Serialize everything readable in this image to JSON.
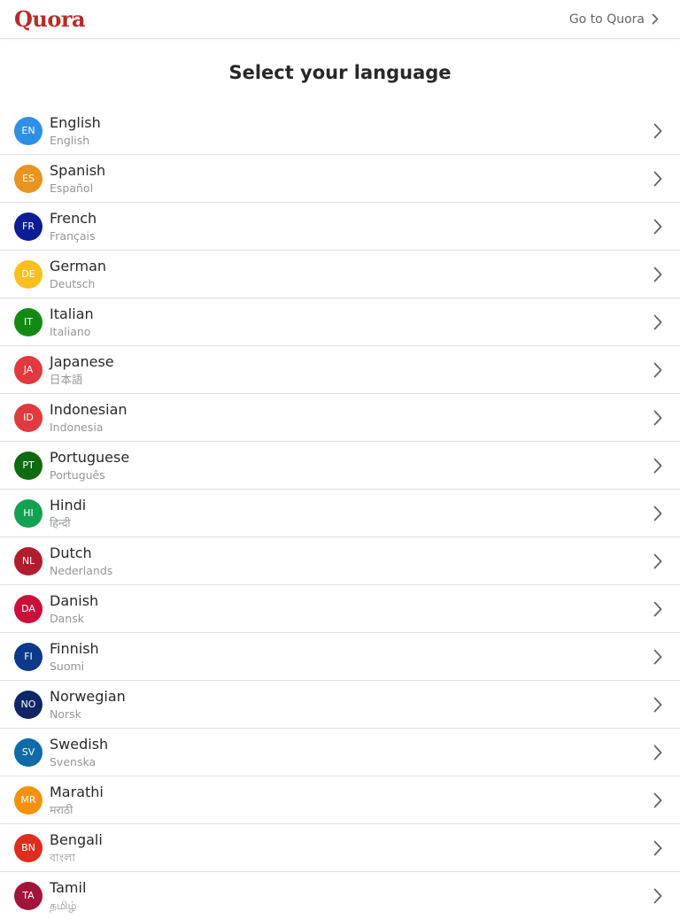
{
  "header": {
    "logo_text": "Quora",
    "logo_color": "#b92b27",
    "goto_label": "Go to Quora",
    "goto_icon": "chevron-right-icon"
  },
  "page": {
    "title": "Select your language"
  },
  "languages": [
    {
      "code": "EN",
      "name": "English",
      "native": "English",
      "color": "#2e90e4"
    },
    {
      "code": "ES",
      "name": "Spanish",
      "native": "Español",
      "color": "#e89421"
    },
    {
      "code": "FR",
      "name": "French",
      "native": "Français",
      "color": "#0b1c95"
    },
    {
      "code": "DE",
      "name": "German",
      "native": "Deutsch",
      "color": "#f9bf1e"
    },
    {
      "code": "IT",
      "name": "Italian",
      "native": "Italiano",
      "color": "#138a13"
    },
    {
      "code": "JA",
      "name": "Japanese",
      "native": "日本語",
      "color": "#e03a3e"
    },
    {
      "code": "ID",
      "name": "Indonesian",
      "native": "Indonesia",
      "color": "#e03a3e"
    },
    {
      "code": "PT",
      "name": "Portuguese",
      "native": "Português",
      "color": "#0f6b0f"
    },
    {
      "code": "HI",
      "name": "Hindi",
      "native": "हिन्दी",
      "color": "#11a152"
    },
    {
      "code": "NL",
      "name": "Dutch",
      "native": "Nederlands",
      "color": "#b01e2d"
    },
    {
      "code": "DA",
      "name": "Danish",
      "native": "Dansk",
      "color": "#c8103b"
    },
    {
      "code": "FI",
      "name": "Finnish",
      "native": "Suomi",
      "color": "#0b3a8a"
    },
    {
      "code": "NO",
      "name": "Norwegian",
      "native": "Norsk",
      "color": "#0e2566"
    },
    {
      "code": "SV",
      "name": "Swedish",
      "native": "Svenska",
      "color": "#0e6aa8"
    },
    {
      "code": "MR",
      "name": "Marathi",
      "native": "मराठी",
      "color": "#f5910f"
    },
    {
      "code": "BN",
      "name": "Bengali",
      "native": "বাংলা",
      "color": "#de2c1e"
    },
    {
      "code": "TA",
      "name": "Tamil",
      "native": "தமிழ்",
      "color": "#a1143c"
    }
  ],
  "row_icon": "chevron-right-icon"
}
